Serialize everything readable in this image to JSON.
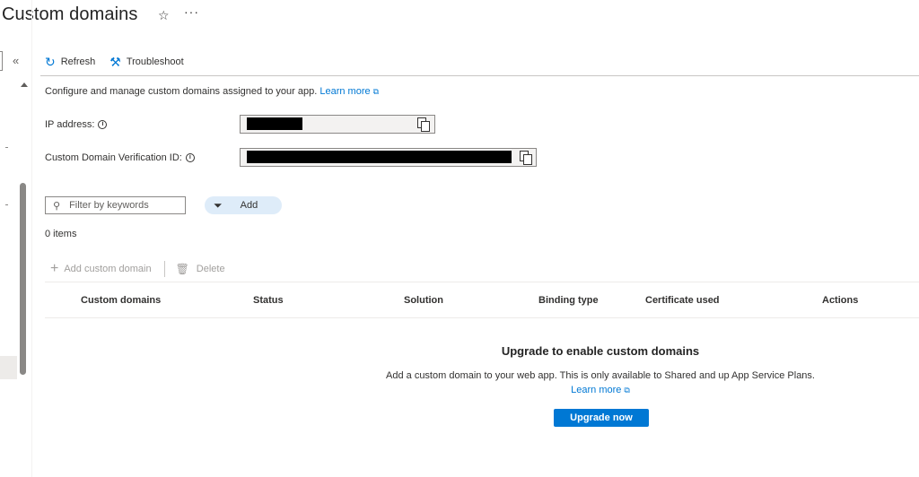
{
  "header": {
    "title": "Custom domains",
    "star_icon": "star-icon",
    "more_icon": "more-icon"
  },
  "rail": {
    "collapse_icon": "chevron-double-left-icon"
  },
  "toolbar": {
    "refresh_label": "Refresh",
    "refresh_icon": "refresh-icon",
    "troubleshoot_label": "Troubleshoot",
    "troubleshoot_icon": "wrench-icon"
  },
  "description": {
    "text": "Configure and manage custom domains assigned to your app.",
    "link": "Learn more"
  },
  "fields": {
    "ip_label": "IP address:",
    "verification_label": "Custom Domain Verification ID:"
  },
  "filter": {
    "placeholder": "Filter by keywords",
    "add_label": "Add"
  },
  "count": "0 items",
  "actions": {
    "add_domain": "Add custom domain",
    "delete": "Delete"
  },
  "table": {
    "columns": [
      "Custom domains",
      "Status",
      "Solution",
      "Binding type",
      "Certificate used",
      "Actions"
    ]
  },
  "empty_state": {
    "title": "Upgrade to enable custom domains",
    "description": "Add a custom domain to your web app. This is only available to Shared and up App Service Plans.",
    "link": "Learn more",
    "button": "Upgrade now"
  },
  "colors": {
    "accent": "#0078d4",
    "pill_bg": "#deecf9"
  }
}
